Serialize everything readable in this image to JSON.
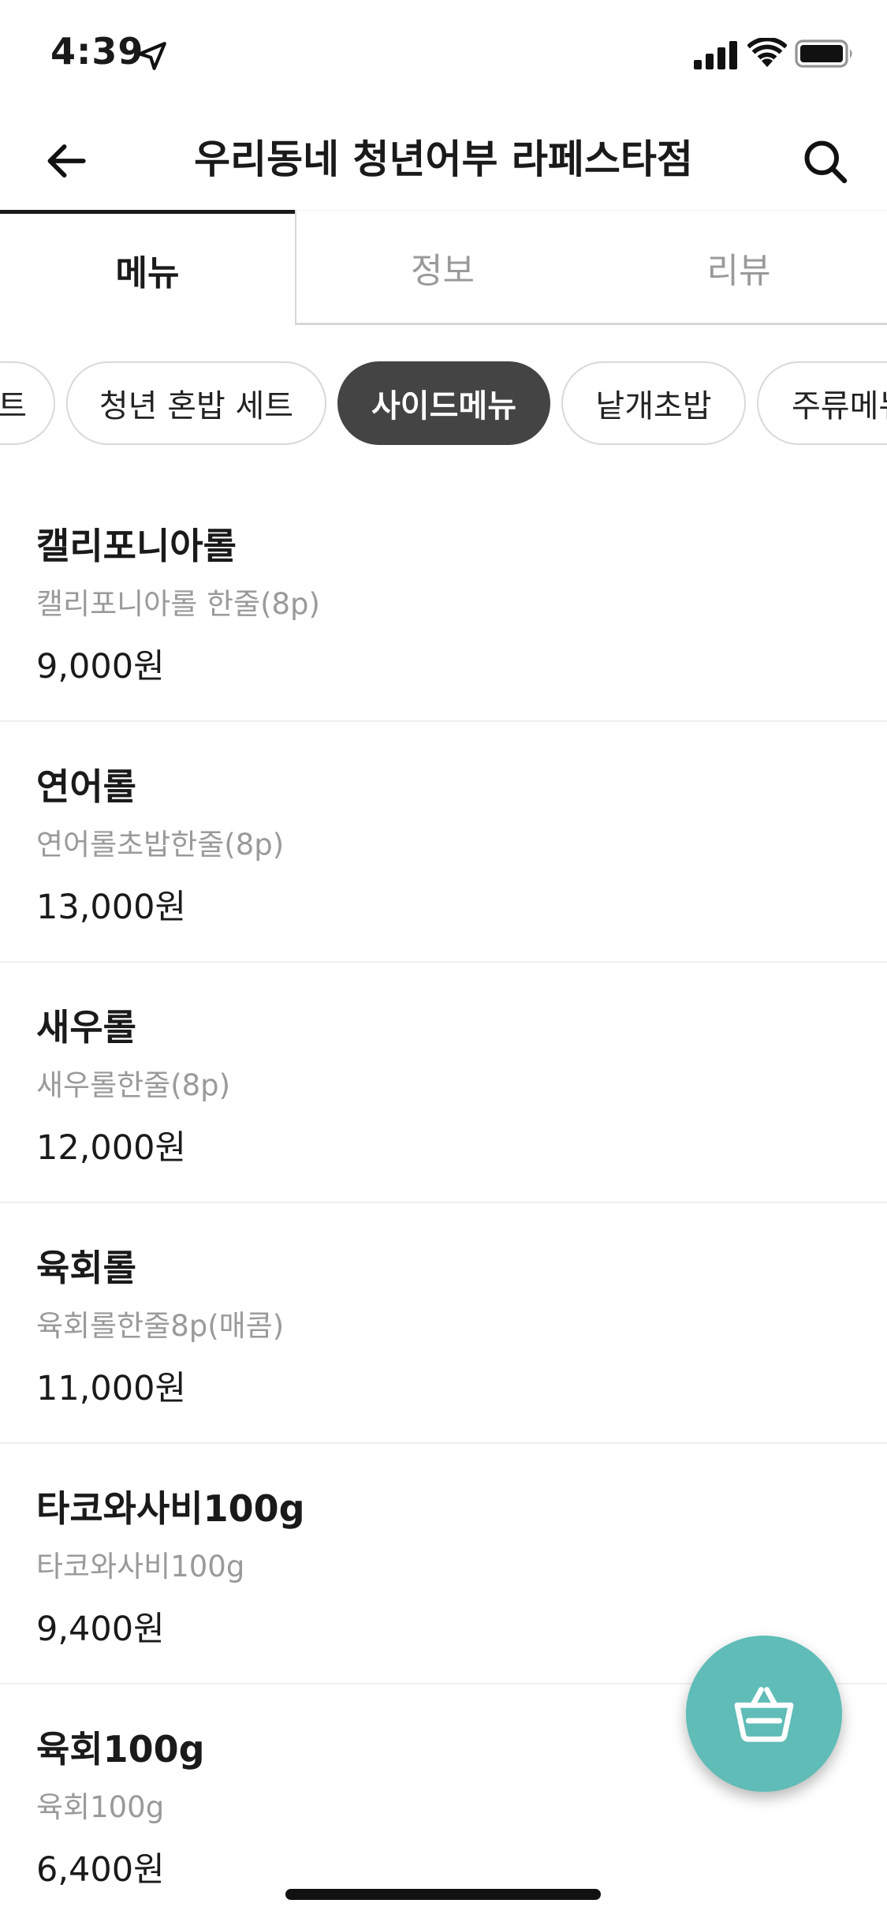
{
  "status_bar": {
    "time": "4:39",
    "icons": [
      "location-arrow-icon",
      "cellular-signal-icon",
      "wifi-icon",
      "battery-icon"
    ]
  },
  "header": {
    "title": "우리동네 청년어부 라페스타점",
    "back_icon": "back-arrow-icon",
    "search_icon": "search-icon"
  },
  "tabs": [
    {
      "label": "메뉴",
      "active": true
    },
    {
      "label": "정보",
      "active": false
    },
    {
      "label": "리뷰",
      "active": false
    }
  ],
  "categories": [
    {
      "label": "트",
      "selected": false
    },
    {
      "label": "청년 혼밥 세트",
      "selected": false
    },
    {
      "label": "사이드메뉴",
      "selected": true
    },
    {
      "label": "낱개초밥",
      "selected": false
    },
    {
      "label": "주류메뉴",
      "selected": false
    }
  ],
  "menu_items": [
    {
      "name": "캘리포니아롤",
      "description": "캘리포니아롤 한줄(8p)",
      "price": "9,000원"
    },
    {
      "name": "연어롤",
      "description": "연어롤초밥한줄(8p)",
      "price": "13,000원"
    },
    {
      "name": "새우롤",
      "description": "새우롤한줄(8p)",
      "price": "12,000원"
    },
    {
      "name": "육회롤",
      "description": "육회롤한줄8p(매콤)",
      "price": "11,000원"
    },
    {
      "name": "타코와사비100g",
      "description": "타코와사비100g",
      "price": "9,400원"
    },
    {
      "name": "육회100g",
      "description": "육회100g",
      "price": "6,400원"
    }
  ],
  "cart": {
    "icon": "shopping-basket-icon"
  },
  "colors": {
    "accent": "#5fbcb7",
    "chip_selected": "#444444",
    "muted_text": "#9a9a9a",
    "primary_text": "#1a1a1a"
  }
}
